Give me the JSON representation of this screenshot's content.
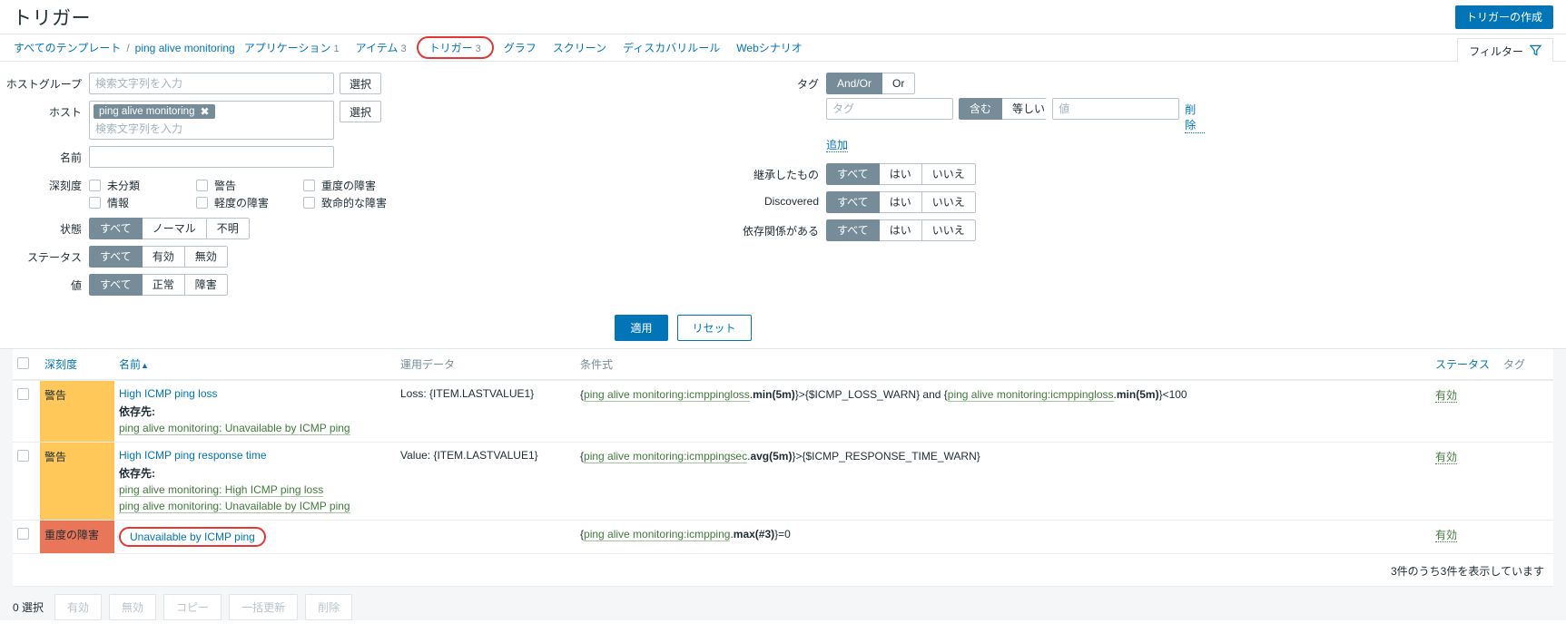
{
  "header": {
    "title": "トリガー",
    "create_button": "トリガーの作成"
  },
  "nav": {
    "breadcrumb_root": "すべてのテンプレート",
    "breadcrumb_sep": "/",
    "breadcrumb_current": "ping alive monitoring",
    "items": [
      {
        "label": "アプリケーション",
        "count": "1",
        "active": false
      },
      {
        "label": "アイテム",
        "count": "3",
        "active": false
      },
      {
        "label": "トリガー",
        "count": "3",
        "active": true
      },
      {
        "label": "グラフ",
        "count": "",
        "active": false
      },
      {
        "label": "スクリーン",
        "count": "",
        "active": false
      },
      {
        "label": "ディスカバリルール",
        "count": "",
        "active": false
      },
      {
        "label": "Webシナリオ",
        "count": "",
        "active": false
      }
    ],
    "filter_tab": "フィルター",
    "filter_icon": "funnel-icon"
  },
  "filter": {
    "hostgroup": {
      "label": "ホストグループ",
      "placeholder": "検索文字列を入力",
      "value": "",
      "select_button": "選択"
    },
    "host": {
      "label": "ホスト",
      "chip": "ping alive monitoring",
      "chip_remove_icon": "close-icon",
      "placeholder": "検索文字列を入力",
      "select_button": "選択"
    },
    "name": {
      "label": "名前",
      "value": "",
      "placeholder": ""
    },
    "severity": {
      "label": "深刻度",
      "options": [
        {
          "label": "未分類",
          "checked": false
        },
        {
          "label": "警告",
          "checked": false
        },
        {
          "label": "重度の障害",
          "checked": false
        },
        {
          "label": "情報",
          "checked": false
        },
        {
          "label": "軽度の障害",
          "checked": false
        },
        {
          "label": "致命的な障害",
          "checked": false
        }
      ]
    },
    "state": {
      "label": "状態",
      "options": [
        "すべて",
        "ノーマル",
        "不明"
      ],
      "selected": "すべて"
    },
    "status": {
      "label": "ステータス",
      "options": [
        "すべて",
        "有効",
        "無効"
      ],
      "selected": "すべて"
    },
    "value": {
      "label": "値",
      "options": [
        "すべて",
        "正常",
        "障害"
      ],
      "selected": "すべて"
    },
    "tags": {
      "label": "タグ",
      "operator_options": [
        "And/Or",
        "Or"
      ],
      "operator_selected": "And/Or",
      "tag_placeholder": "タグ",
      "tag_value": "",
      "match_options": [
        "含む",
        "等しい"
      ],
      "match_selected": "含む",
      "value_placeholder": "値",
      "value_value": "",
      "remove_link": "削除",
      "add_link": "追加"
    },
    "inherited": {
      "label": "継承したもの",
      "options": [
        "すべて",
        "はい",
        "いいえ"
      ],
      "selected": "すべて"
    },
    "discovered": {
      "label": "Discovered",
      "options": [
        "すべて",
        "はい",
        "いいえ"
      ],
      "selected": "すべて"
    },
    "dependency": {
      "label": "依存関係がある",
      "options": [
        "すべて",
        "はい",
        "いいえ"
      ],
      "selected": "すべて"
    },
    "apply_button": "適用",
    "reset_button": "リセット"
  },
  "table": {
    "columns": {
      "severity": "深刻度",
      "name": "名前",
      "name_sort_icon": "▲",
      "operational_data": "運用データ",
      "expression": "条件式",
      "status": "ステータス",
      "tags": "タグ"
    },
    "rows": [
      {
        "severity": "警告",
        "severity_class": "sev-warning",
        "name": "High ICMP ping loss",
        "name_circled": false,
        "dependency_label": "依存先:",
        "dependencies": [
          "ping alive monitoring: Unavailable by ICMP ping"
        ],
        "operational_data": "Loss: {ITEM.LASTVALUE1}",
        "expression_parts": [
          {
            "t": "{",
            "k": "plain"
          },
          {
            "t": "ping alive monitoring:icmppingloss",
            "k": "ref"
          },
          {
            "t": ".",
            "k": "plain"
          },
          {
            "t": "min(5m)",
            "k": "bold"
          },
          {
            "t": "}>{$ICMP_LOSS_WARN} and {",
            "k": "plain"
          },
          {
            "t": "ping alive monitoring:icmppingloss",
            "k": "ref"
          },
          {
            "t": ".",
            "k": "plain"
          },
          {
            "t": "min(5m)",
            "k": "bold"
          },
          {
            "t": "}<100",
            "k": "plain"
          }
        ],
        "status": "有効",
        "tags": ""
      },
      {
        "severity": "警告",
        "severity_class": "sev-warning",
        "name": "High ICMP ping response time",
        "name_circled": false,
        "dependency_label": "依存先:",
        "dependencies": [
          "ping alive monitoring: High ICMP ping loss",
          "ping alive monitoring: Unavailable by ICMP ping"
        ],
        "operational_data": "Value: {ITEM.LASTVALUE1}",
        "expression_parts": [
          {
            "t": "{",
            "k": "plain"
          },
          {
            "t": "ping alive monitoring:icmppingsec",
            "k": "ref"
          },
          {
            "t": ".",
            "k": "plain"
          },
          {
            "t": "avg(5m)",
            "k": "bold"
          },
          {
            "t": "}>{$ICMP_RESPONSE_TIME_WARN}",
            "k": "plain"
          }
        ],
        "status": "有効",
        "tags": ""
      },
      {
        "severity": "重度の障害",
        "severity_class": "sev-high",
        "name": "Unavailable by ICMP ping",
        "name_circled": true,
        "dependency_label": "",
        "dependencies": [],
        "operational_data": "",
        "expression_parts": [
          {
            "t": "{",
            "k": "plain"
          },
          {
            "t": "ping alive monitoring:icmpping",
            "k": "ref"
          },
          {
            "t": ".",
            "k": "plain"
          },
          {
            "t": "max(#3)",
            "k": "bold"
          },
          {
            "t": "}=0",
            "k": "plain"
          }
        ],
        "status": "有効",
        "tags": ""
      }
    ],
    "row_count_text": "3件のうち3件を表示しています"
  },
  "footer": {
    "selected_text": "0 選択",
    "buttons": [
      "有効",
      "無効",
      "コピー",
      "一括更新",
      "削除"
    ]
  }
}
